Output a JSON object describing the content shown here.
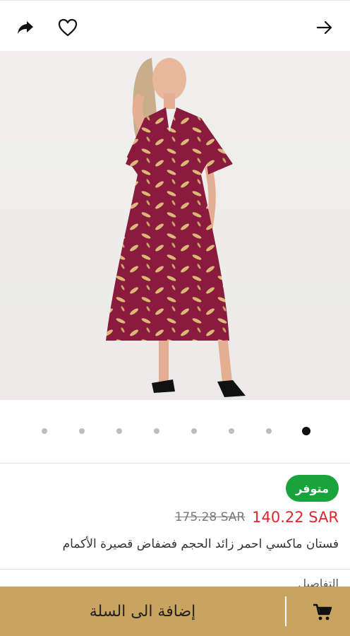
{
  "header": {
    "share_icon": "share-icon",
    "wishlist_icon": "heart-icon",
    "back_icon": "arrow-right-icon"
  },
  "gallery": {
    "image_count": 8,
    "active_index": 8
  },
  "product": {
    "availability": "متوفر",
    "old_price": "175.28 SAR",
    "new_price": "140.22 SAR",
    "title": "فستان ماكسي احمر زائد الحجم فضفاض قصيرة الأكمام",
    "next_section_peek": "التفاصيل"
  },
  "cart": {
    "label": "إضافة الى السلة",
    "icon": "cart-icon"
  },
  "colors": {
    "accent": "#C9A460",
    "available": "#1AA33A",
    "sale_price": "#E0252B"
  }
}
